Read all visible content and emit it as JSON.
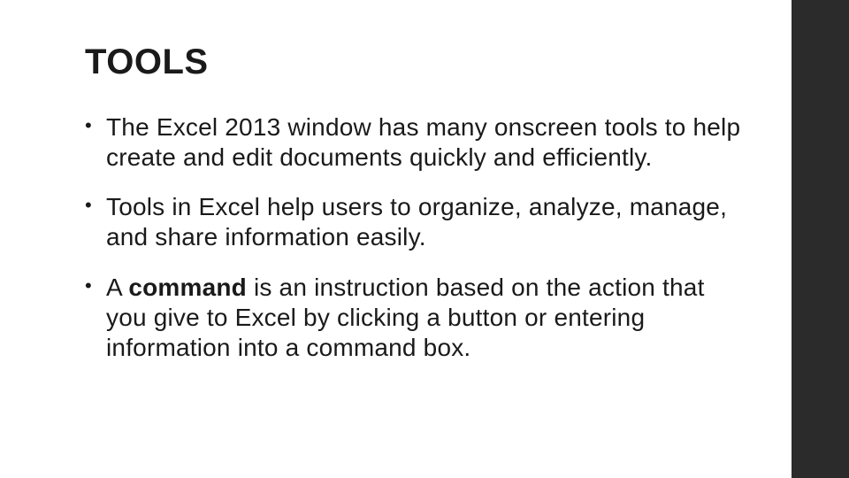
{
  "title": "TOOLS",
  "bullets": [
    {
      "runs": [
        {
          "text": "The Excel 2013 window has many onscreen tools to help create and edit documents quickly and efficiently.",
          "bold": false
        }
      ]
    },
    {
      "runs": [
        {
          "text": "Tools in Excel help users to organize, analyze, manage, and share information easily.",
          "bold": false
        }
      ]
    },
    {
      "runs": [
        {
          "text": "A ",
          "bold": false
        },
        {
          "text": "command",
          "bold": true
        },
        {
          "text": " is an instruction based on the action that you give to Excel by clicking a button or entering information into a command box.",
          "bold": false
        }
      ]
    }
  ]
}
